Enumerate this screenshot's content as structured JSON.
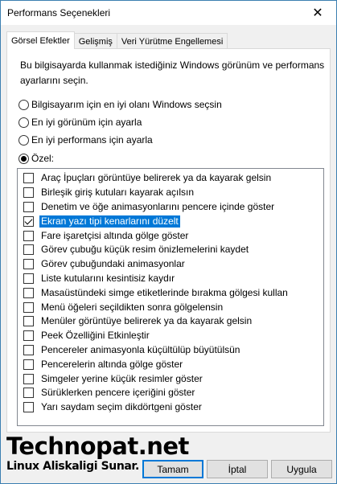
{
  "window": {
    "title": "Performans Seçenekleri",
    "close_glyph": "✕"
  },
  "tabs": [
    {
      "label": "Görsel Efektler",
      "active": true
    },
    {
      "label": "Gelişmiş",
      "active": false
    },
    {
      "label": "Veri Yürütme Engellemesi",
      "active": false
    }
  ],
  "description": "Bu bilgisayarda kullanmak istediğiniz Windows görünüm ve performans ayarlarını seçin.",
  "radios": [
    {
      "label": "Bilgisayarım için en iyi olanı Windows seçsin",
      "checked": false
    },
    {
      "label": "En iyi görünüm için ayarla",
      "checked": false
    },
    {
      "label": "En iyi performans için ayarla",
      "checked": false
    },
    {
      "label": "Özel:",
      "checked": true
    }
  ],
  "options": [
    {
      "label": "Araç İpuçları görüntüye belirerek ya da kayarak gelsin",
      "checked": false
    },
    {
      "label": "Birleşik giriş kutuları kayarak açılsın",
      "checked": false
    },
    {
      "label": "Denetim ve öğe animasyonlarını pencere içinde göster",
      "checked": false
    },
    {
      "label": "Ekran yazı tipi kenarlarını düzelt",
      "checked": true,
      "selected": true
    },
    {
      "label": "Fare işaretçisi altında gölge göster",
      "checked": false
    },
    {
      "label": "Görev çubuğu küçük resim önizlemelerini kaydet",
      "checked": false
    },
    {
      "label": "Görev çubuğundaki animasyonlar",
      "checked": false
    },
    {
      "label": "Liste kutularını kesintisiz kaydır",
      "checked": false
    },
    {
      "label": "Masaüstündeki simge etiketlerinde bırakma gölgesi kullan",
      "checked": false
    },
    {
      "label": "Menü öğeleri seçildikten sonra gölgelensin",
      "checked": false
    },
    {
      "label": "Menüler görüntüye belirerek ya da kayarak gelsin",
      "checked": false
    },
    {
      "label": "Peek Özelliğini Etkinleştir",
      "checked": false
    },
    {
      "label": "Pencereler animasyonla küçültülüp büyütülsün",
      "checked": false
    },
    {
      "label": "Pencerelerin altında gölge göster",
      "checked": false
    },
    {
      "label": "Simgeler yerine küçük resimler göster",
      "checked": false
    },
    {
      "label": "Sürüklerken pencere içeriğini göster",
      "checked": false
    },
    {
      "label": "Yarı saydam seçim dikdörtgeni göster",
      "checked": false
    }
  ],
  "watermark": {
    "main": "Technopat.net",
    "sub": "Linux Aliskaligi Sunar."
  },
  "buttons": {
    "ok": "Tamam",
    "cancel": "İptal",
    "apply": "Uygula"
  },
  "colors": {
    "selection": "#0078d7",
    "window_border": "#3c7fb1"
  }
}
